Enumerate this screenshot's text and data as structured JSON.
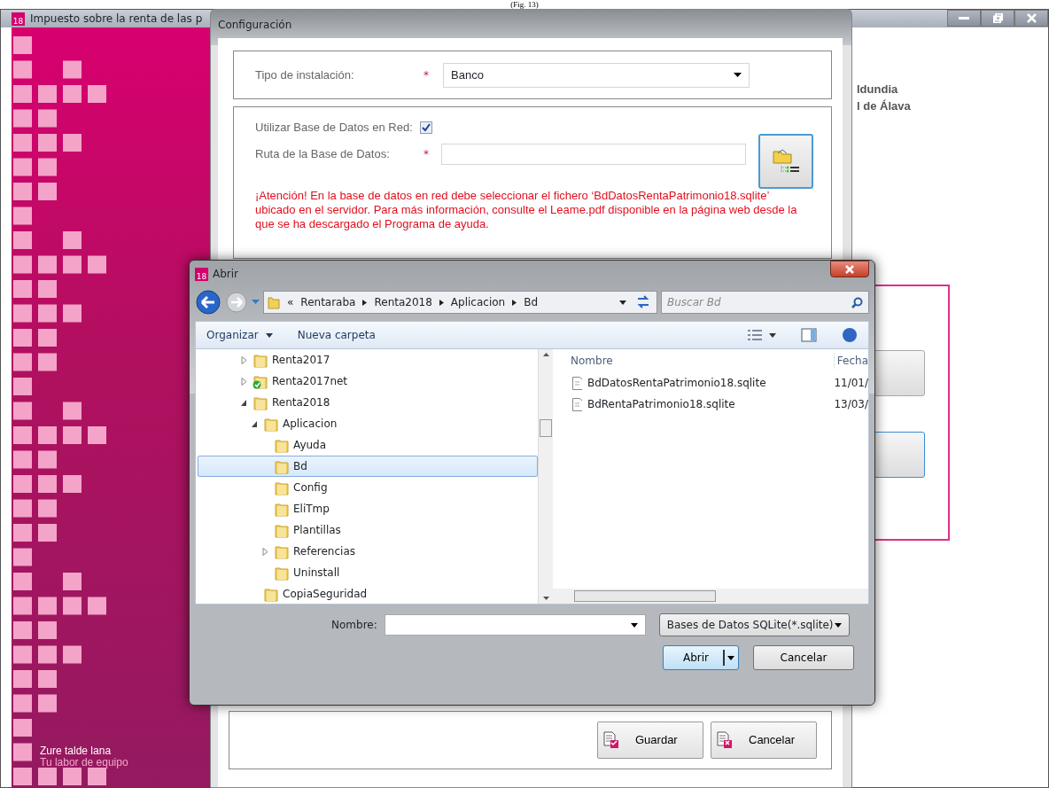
{
  "caption": "(Fig. 13)",
  "main_window": {
    "title": "Impuesto sobre la renta de las p",
    "icon_text": "18",
    "slogan": [
      "Zure talde lana",
      "Tu labor de equipo"
    ],
    "right_text": [
      "ldundia",
      "l de Álava"
    ]
  },
  "config_dialog": {
    "title": "Configuración",
    "install_type": {
      "label": "Tipo de instalación:",
      "required_mark": "*",
      "value": "Banco"
    },
    "network_db": {
      "label": "Utilizar Base de Datos en Red:",
      "checked": true
    },
    "db_path": {
      "label": "Ruta de la Base de Datos:",
      "required_mark": "*"
    },
    "warning": "¡Atención! En la base de datos en red debe seleccionar el fichero ‘BdDatosRentaPatrimonio18.sqlite’ ubicado en el servidor. Para más información, consulte el Leame.pdf disponible en la página web desde la que se ha descargado el Programa de ayuda.",
    "buttons": [
      {
        "label": "Guardar",
        "kind": "save"
      },
      {
        "label": "Cancelar",
        "kind": "cancel"
      }
    ]
  },
  "open_dialog": {
    "title": "Abrir",
    "icon_text": "18",
    "breadcrumb_overflow": "«",
    "breadcrumb": [
      "Rentaraba",
      "Renta2018",
      "Aplicacion",
      "Bd"
    ],
    "search_placeholder": "Buscar Bd",
    "toolbar": [
      "Organizar",
      "Nueva carpeta"
    ],
    "tree": [
      {
        "label": "Renta2017",
        "kind": "folder",
        "expandable": true,
        "expanded": false,
        "selected": false
      },
      {
        "label": "Renta2017net",
        "kind": "synced-folder",
        "expandable": true,
        "expanded": false,
        "selected": false
      },
      {
        "label": "Renta2018",
        "kind": "folder",
        "expandable": true,
        "expanded": true,
        "selected": false,
        "children": [
          {
            "label": "Aplicacion",
            "kind": "folder",
            "expandable": true,
            "expanded": true,
            "selected": false,
            "children": [
              {
                "label": "Ayuda",
                "kind": "folder",
                "expandable": false,
                "selected": false
              },
              {
                "label": "Bd",
                "kind": "folder",
                "expandable": false,
                "selected": true
              },
              {
                "label": "Config",
                "kind": "folder",
                "expandable": false,
                "selected": false
              },
              {
                "label": "EliTmp",
                "kind": "folder",
                "expandable": false,
                "selected": false
              },
              {
                "label": "Plantillas",
                "kind": "folder",
                "expandable": false,
                "selected": false
              },
              {
                "label": "Referencias",
                "kind": "folder",
                "expandable": true,
                "expanded": false,
                "selected": false
              },
              {
                "label": "Uninstall",
                "kind": "folder",
                "expandable": false,
                "selected": false
              }
            ]
          },
          {
            "label": "CopiaSeguridad",
            "kind": "folder",
            "expandable": false,
            "selected": false
          }
        ]
      }
    ],
    "columns": [
      "Nombre",
      "Fecha"
    ],
    "files": [
      {
        "name": "BdDatosRentaPatrimonio18.sqlite",
        "date": "11/01/"
      },
      {
        "name": "BdRentaPatrimonio18.sqlite",
        "date": "13/03/"
      }
    ],
    "filename_label": "Nombre:",
    "filter": "Bases de Datos SQLite(*.sqlite)",
    "buttons": [
      {
        "label": "Abrir",
        "kind": "split"
      },
      {
        "label": "Cancelar",
        "kind": "plain"
      }
    ]
  }
}
